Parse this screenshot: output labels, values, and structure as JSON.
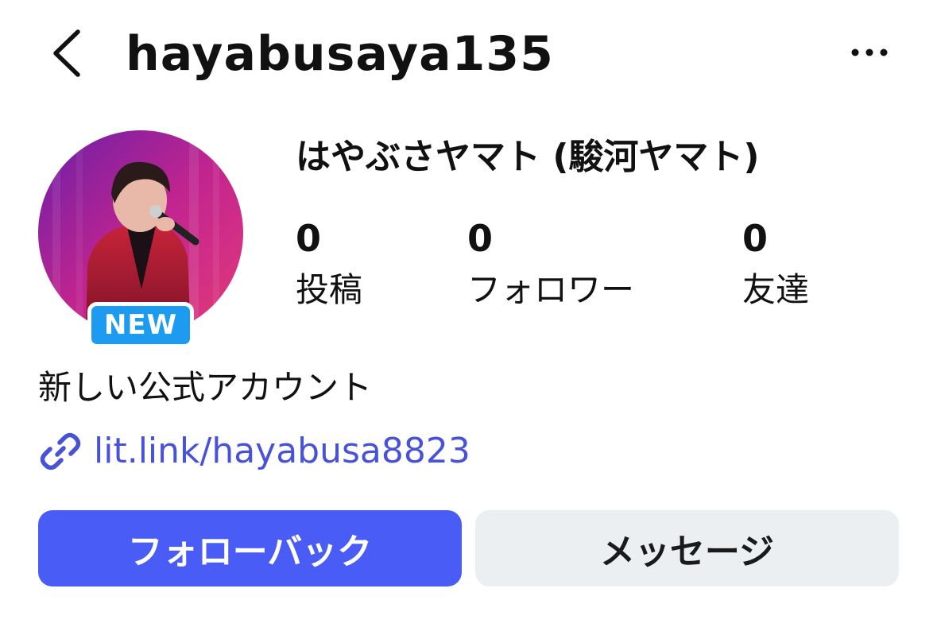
{
  "header": {
    "username": "hayabusaya135"
  },
  "profile": {
    "badge": "NEW",
    "display_name": "はやぶさヤマト (駿河ヤマト)",
    "stats": [
      {
        "value": "0",
        "label": "投稿"
      },
      {
        "value": "0",
        "label": "フォロワー"
      },
      {
        "value": "0",
        "label": "友達"
      }
    ],
    "bio": "新しい公式アカウント",
    "link": "lit.link/hayabusa8823"
  },
  "actions": {
    "follow_back_label": "フォローバック",
    "message_label": "メッセージ"
  },
  "icons": {
    "back": "chevron-left-icon",
    "more": "more-horizontal-icon",
    "link": "link-icon"
  },
  "colors": {
    "primary_button": "#4a5cf6",
    "secondary_button": "#eceff2",
    "link": "#4752d6",
    "badge": "#1d9bf0"
  }
}
